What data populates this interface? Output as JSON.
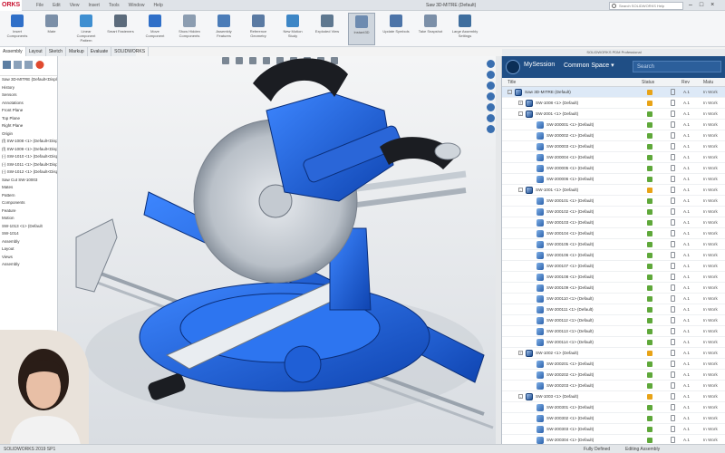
{
  "app": {
    "logo_text": "DS SOLIDWORKS",
    "logo_short": "ORKS"
  },
  "title_bar": {
    "menus": [
      "File",
      "Edit",
      "View",
      "Insert",
      "Tools",
      "Window",
      "Help"
    ],
    "doc_title": "Saw 3D-MITRE (Default)",
    "search_placeholder": "Search SOLIDWORKS Help",
    "window_controls": [
      "–",
      "□",
      "×"
    ]
  },
  "ribbon": {
    "buttons": [
      {
        "label": "Insert Components",
        "icon": "insert-component-icon"
      },
      {
        "label": "Mate",
        "icon": "mate-icon"
      },
      {
        "label": "Linear Component Pattern",
        "icon": "pattern-icon"
      },
      {
        "label": "Smart Fasteners",
        "icon": "fastener-icon"
      },
      {
        "label": "Move Component",
        "icon": "move-icon"
      },
      {
        "label": "Show Hidden Components",
        "icon": "show-hidden-icon"
      },
      {
        "label": "Assembly Features",
        "icon": "assembly-features-icon"
      },
      {
        "label": "Reference Geometry",
        "icon": "reference-geometry-icon"
      },
      {
        "label": "New Motion Study",
        "icon": "motion-study-icon"
      },
      {
        "label": "Exploded View",
        "icon": "exploded-view-icon"
      },
      {
        "label": "Instant3D",
        "icon": "instant3d-icon"
      },
      {
        "label": "Update Symbols",
        "icon": "update-symbols-icon"
      },
      {
        "label": "Take Snapshot",
        "icon": "snapshot-icon"
      },
      {
        "label": "Large Assembly Settings",
        "icon": "large-assembly-icon"
      }
    ],
    "active_index": 10
  },
  "command_tabs": [
    "Assembly",
    "Layout",
    "Sketch",
    "Markup",
    "Evaluate",
    "SOLIDWORKS Add-Ins"
  ],
  "feature_tree": {
    "lines": [
      "Saw 3D-MITRE (Default<Display",
      "History",
      "Sensors",
      "Annotations",
      "Front Plane",
      "Top Plane",
      "Right Plane",
      "Origin",
      "(f) SW-1008 <1> (Default<Disp",
      "(f) SW-1009 <1> (Default<Disp",
      "(-) SW-1010 <1> (Default<Disp",
      "(-) SW-1011 <1> (Default<Disp",
      "(-) SW-1012 <1> (Default<Disp",
      "Saw Cut SW-10003",
      "Mates",
      "Pattern",
      "Components",
      "Feature",
      "Motion",
      "SW-1013 <1> (Default",
      "SW-1014",
      "Assembly",
      "Layout",
      "Views",
      "Assembly"
    ]
  },
  "pdm": {
    "topbar_text": "SOLIDWORKS PDM Professional",
    "app_name": "MySession",
    "context": "Common Space",
    "search_placeholder": "Search",
    "columns": {
      "title": "Title",
      "status": "Status",
      "rev": "Rev",
      "maturity": "Matu"
    },
    "rows": [
      {
        "name": "Saw 3D-MITRE (Default)",
        "indent": 0,
        "type": "asm",
        "expand": "-",
        "status_color": "#e8a317",
        "rev": "A.1",
        "maturity": "In Work",
        "selected": true
      },
      {
        "name": "SW-1008 <1> (Default)",
        "indent": 1,
        "type": "asm",
        "expand": "+",
        "status_color": "#e8a317",
        "rev": "A.1",
        "maturity": "In Work"
      },
      {
        "name": "SW-2001 <1> (Default)",
        "indent": 1,
        "type": "asm",
        "expand": "-",
        "status_color": "#5fa83a",
        "rev": "A.1",
        "maturity": "In Work"
      },
      {
        "name": "SW-200001 <1> (Default)",
        "indent": 2,
        "type": "part",
        "expand": "",
        "status_color": "#5fa83a",
        "rev": "A.1",
        "maturity": "In Work"
      },
      {
        "name": "SW-200002 <1> (Default)",
        "indent": 2,
        "type": "part",
        "expand": "",
        "status_color": "#5fa83a",
        "rev": "A.1",
        "maturity": "In Work"
      },
      {
        "name": "SW-200003 <1> (Default)",
        "indent": 2,
        "type": "part",
        "expand": "",
        "status_color": "#5fa83a",
        "rev": "A.1",
        "maturity": "In Work"
      },
      {
        "name": "SW-200004 <1> (Default)",
        "indent": 2,
        "type": "part",
        "expand": "",
        "status_color": "#5fa83a",
        "rev": "A.1",
        "maturity": "In Work"
      },
      {
        "name": "SW-200005 <1> (Default)",
        "indent": 2,
        "type": "part",
        "expand": "",
        "status_color": "#5fa83a",
        "rev": "A.1",
        "maturity": "In Work"
      },
      {
        "name": "SW-200006 <1> (Default)",
        "indent": 2,
        "type": "part",
        "expand": "",
        "status_color": "#5fa83a",
        "rev": "A.1",
        "maturity": "In Work"
      },
      {
        "name": "SW-1001 <1> (Default)",
        "indent": 1,
        "type": "asm",
        "expand": "-",
        "status_color": "#e8a317",
        "rev": "A.1",
        "maturity": "In Work"
      },
      {
        "name": "SW-200101 <1> (Default)",
        "indent": 2,
        "type": "part",
        "expand": "",
        "status_color": "#5fa83a",
        "rev": "A.1",
        "maturity": "In Work"
      },
      {
        "name": "SW-200102 <1> (Default)",
        "indent": 2,
        "type": "part",
        "expand": "",
        "status_color": "#5fa83a",
        "rev": "A.1",
        "maturity": "In Work"
      },
      {
        "name": "SW-200103 <1> (Default)",
        "indent": 2,
        "type": "part",
        "expand": "",
        "status_color": "#5fa83a",
        "rev": "A.1",
        "maturity": "In Work"
      },
      {
        "name": "SW-200104 <1> (Default)",
        "indent": 2,
        "type": "part",
        "expand": "",
        "status_color": "#5fa83a",
        "rev": "A.1",
        "maturity": "In Work"
      },
      {
        "name": "SW-200105 <1> (Default)",
        "indent": 2,
        "type": "part",
        "expand": "",
        "status_color": "#5fa83a",
        "rev": "A.1",
        "maturity": "In Work"
      },
      {
        "name": "SW-200106 <1> (Default)",
        "indent": 2,
        "type": "part",
        "expand": "",
        "status_color": "#5fa83a",
        "rev": "A.1",
        "maturity": "In Work"
      },
      {
        "name": "SW-200107 <1> (Default)",
        "indent": 2,
        "type": "part",
        "expand": "",
        "status_color": "#5fa83a",
        "rev": "A.1",
        "maturity": "In Work"
      },
      {
        "name": "SW-200108 <1> (Default)",
        "indent": 2,
        "type": "part",
        "expand": "",
        "status_color": "#5fa83a",
        "rev": "A.1",
        "maturity": "In Work"
      },
      {
        "name": "SW-200109 <1> (Default)",
        "indent": 2,
        "type": "part",
        "expand": "",
        "status_color": "#5fa83a",
        "rev": "A.1",
        "maturity": "In Work"
      },
      {
        "name": "SW-200110 <1> (Default)",
        "indent": 2,
        "type": "part",
        "expand": "",
        "status_color": "#5fa83a",
        "rev": "A.1",
        "maturity": "In Work"
      },
      {
        "name": "SW-200111 <1> (Default)",
        "indent": 2,
        "type": "part",
        "expand": "",
        "status_color": "#5fa83a",
        "rev": "A.1",
        "maturity": "In Work"
      },
      {
        "name": "SW-200112 <1> (Default)",
        "indent": 2,
        "type": "part",
        "expand": "",
        "status_color": "#5fa83a",
        "rev": "A.1",
        "maturity": "In Work"
      },
      {
        "name": "SW-200113 <1> (Default)",
        "indent": 2,
        "type": "part",
        "expand": "",
        "status_color": "#5fa83a",
        "rev": "A.1",
        "maturity": "In Work"
      },
      {
        "name": "SW-200114 <1> (Default)",
        "indent": 2,
        "type": "part",
        "expand": "",
        "status_color": "#5fa83a",
        "rev": "A.1",
        "maturity": "In Work"
      },
      {
        "name": "SW-1002 <1> (Default)",
        "indent": 1,
        "type": "asm",
        "expand": "+",
        "status_color": "#e8a317",
        "rev": "A.1",
        "maturity": "In Work"
      },
      {
        "name": "SW-200201 <1> (Default)",
        "indent": 2,
        "type": "part",
        "expand": "",
        "status_color": "#5fa83a",
        "rev": "A.1",
        "maturity": "In Work"
      },
      {
        "name": "SW-200202 <1> (Default)",
        "indent": 2,
        "type": "part",
        "expand": "",
        "status_color": "#5fa83a",
        "rev": "A.1",
        "maturity": "In Work"
      },
      {
        "name": "SW-200203 <1> (Default)",
        "indent": 2,
        "type": "part",
        "expand": "",
        "status_color": "#5fa83a",
        "rev": "A.1",
        "maturity": "In Work"
      },
      {
        "name": "SW-1003 <1> (Default)",
        "indent": 1,
        "type": "asm",
        "expand": "-",
        "status_color": "#e8a317",
        "rev": "A.1",
        "maturity": "In Work"
      },
      {
        "name": "SW-200301 <1> (Default)",
        "indent": 2,
        "type": "part",
        "expand": "",
        "status_color": "#5fa83a",
        "rev": "A.1",
        "maturity": "In Work"
      },
      {
        "name": "SW-200302 <1> (Default)",
        "indent": 2,
        "type": "part",
        "expand": "",
        "status_color": "#5fa83a",
        "rev": "A.1",
        "maturity": "In Work"
      },
      {
        "name": "SW-200303 <1> (Default)",
        "indent": 2,
        "type": "part",
        "expand": "",
        "status_color": "#5fa83a",
        "rev": "A.1",
        "maturity": "In Work"
      },
      {
        "name": "SW-200304 <1> (Default)",
        "indent": 2,
        "type": "part",
        "expand": "",
        "status_color": "#5fa83a",
        "rev": "A.1",
        "maturity": "In Work"
      }
    ]
  },
  "statusbar": {
    "left": "SOLIDWORKS 2019 SP1",
    "middle": "Fully Defined",
    "right": "Editing Assembly"
  },
  "colors": {
    "accent": "#1f4e85",
    "model_blue": "#1a5fd0",
    "status_ok": "#5fa83a",
    "status_warn": "#e8a317"
  }
}
